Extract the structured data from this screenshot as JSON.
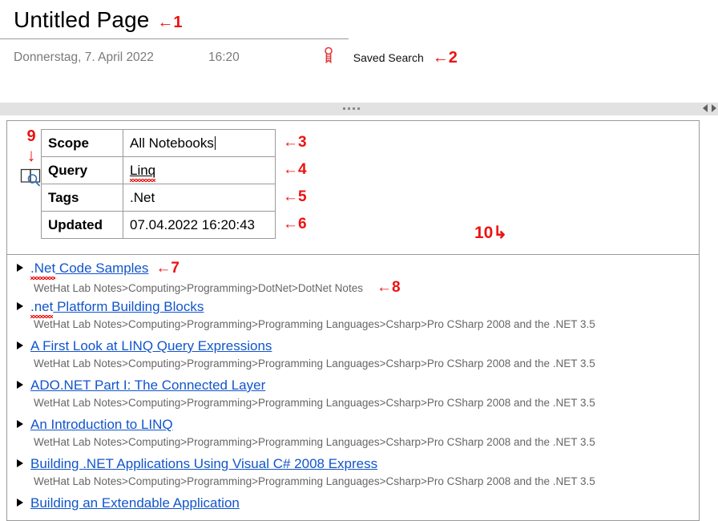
{
  "header": {
    "title": "Untitled Page",
    "date": "Donnerstag, 7. April 2022",
    "time": "16:20",
    "tag_icon": "ribbon-tag-icon",
    "tag_label": "Saved Search"
  },
  "markers": {
    "m1": "←1",
    "m2": "←2",
    "m3": "←3",
    "m4": "←4",
    "m5": "←5",
    "m6": "←6",
    "m7": "←7",
    "m8": "←8",
    "m9_number": "9",
    "m9_arrow": "↓",
    "m10": "10↳"
  },
  "splitter": {
    "grip_icon": "splitter-grip-icon",
    "scroll_left_icon": "scroll-left-arrow-icon",
    "scroll_right_icon": "scroll-right-arrow-icon"
  },
  "query_panel": {
    "icon": "book-search-icon",
    "rows": [
      {
        "key": "Scope",
        "value": "All Notebooks"
      },
      {
        "key": "Query",
        "value": "Linq"
      },
      {
        "key": "Tags",
        "value": ".Net"
      },
      {
        "key": "Updated",
        "value": "07.04.2022 16:20:43"
      }
    ]
  },
  "results": {
    "items": [
      {
        "title": ".Net Code Samples",
        "path": "WetHat Lab Notes>Computing>Programming>DotNet>DotNet Notes"
      },
      {
        "title": ".net Platform Building Blocks",
        "path": "WetHat Lab Notes>Computing>Programming>Programming Languages>Csharp>Pro CSharp 2008 and the .NET 3.5"
      },
      {
        "title": "A First Look at LINQ Query Expressions",
        "path": "WetHat Lab Notes>Computing>Programming>Programming Languages>Csharp>Pro CSharp 2008 and the .NET 3.5"
      },
      {
        "title": "ADO.NET Part I: The Connected Layer",
        "path": "WetHat Lab Notes>Computing>Programming>Programming Languages>Csharp>Pro CSharp 2008 and the .NET 3.5"
      },
      {
        "title": "An Introduction to LINQ",
        "path": "WetHat Lab Notes>Computing>Programming>Programming Languages>Csharp>Pro CSharp 2008 and the .NET 3.5"
      },
      {
        "title": "Building .NET Applications Using Visual C# 2008 Express",
        "path": "WetHat Lab Notes>Computing>Programming>Programming Languages>Csharp>Pro CSharp 2008 and the .NET 3.5"
      },
      {
        "title": "Building an Extendable Application",
        "path": ""
      }
    ]
  },
  "colors": {
    "link": "#1155cc",
    "marker": "#ee1111",
    "path": "#666666",
    "meta": "#7a7a7a",
    "border": "#9a9a9a"
  }
}
